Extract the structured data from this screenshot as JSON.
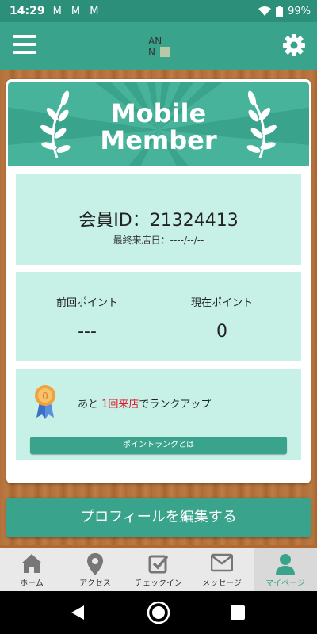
{
  "statusbar": {
    "time": "14:29",
    "notifications": "M M M",
    "battery": "99%"
  },
  "colors": {
    "accent": "#3aa38b",
    "panel": "#c7f0e6",
    "highlight": "#e0192a",
    "wood": "#b06a32"
  },
  "header": {
    "menu_icon": "hamburger-icon",
    "logo": "logo",
    "settings_icon": "gear-icon"
  },
  "banner": {
    "line1": "Mobile",
    "line2": "Member"
  },
  "member": {
    "id_text": "会員ID：21324413",
    "last_visit": "最終来店日：----/--/--"
  },
  "points": {
    "previous_label": "前回ポイント",
    "previous_value": "---",
    "current_label": "現在ポイント",
    "current_value": "0"
  },
  "rank": {
    "prefix": "あと ",
    "highlight": "1回来店",
    "suffix": "でランクアップ",
    "button_label": "ポイントランクとは"
  },
  "profile_button": "プロフィールを編集する",
  "tabs": [
    {
      "label": "ホーム",
      "icon": "home-icon"
    },
    {
      "label": "アクセス",
      "icon": "map-pin-icon"
    },
    {
      "label": "チェックイン",
      "icon": "checkbox-icon"
    },
    {
      "label": "メッセージ",
      "icon": "mail-icon"
    },
    {
      "label": "マイページ",
      "icon": "user-icon",
      "active": true
    }
  ]
}
